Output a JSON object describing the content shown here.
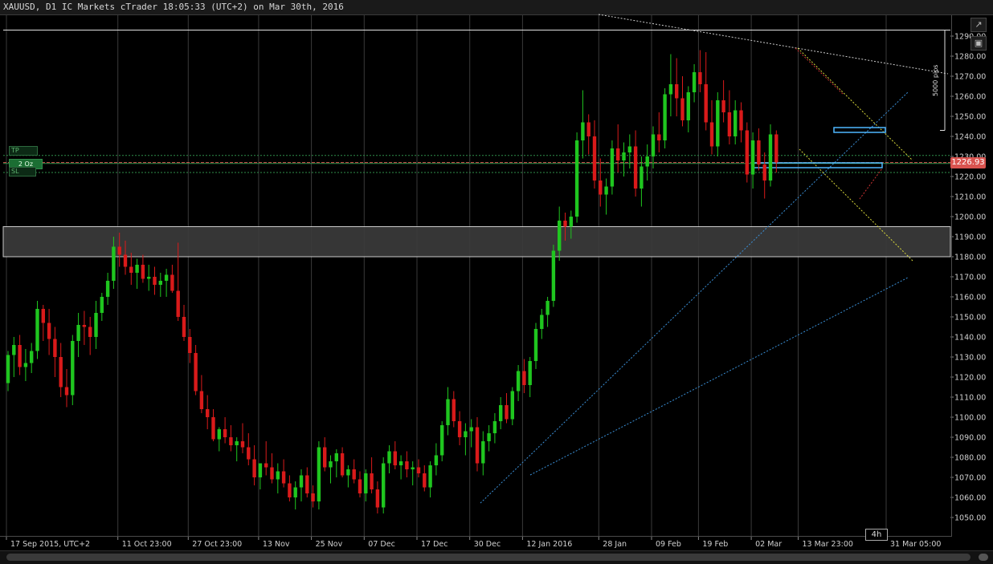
{
  "window": {
    "title": "XAUUSD, D1 IC Markets cTrader 18:05:33 (UTC+2) on Mar 30th, 2016"
  },
  "toolbar": {
    "detach_icon": "external-link-icon",
    "camera_icon": "camera-icon"
  },
  "timeframe_badge": "4h",
  "order": {
    "tp_label": "TP",
    "quantity_label": "2 Oz",
    "sl_label": "SL"
  },
  "measure": {
    "pips_label": "5000 pips"
  },
  "colors": {
    "bull": "#1fc61f",
    "bear": "#d91a1a",
    "background": "#000000",
    "current_price": "#d9534f"
  },
  "chart_data": {
    "type": "candlestick",
    "symbol": "XAUUSD",
    "timeframe": "D1",
    "current_price": 1226.93,
    "y_ticks": [
      1050,
      1060,
      1070,
      1080,
      1090,
      1100,
      1110,
      1120,
      1130,
      1140,
      1150,
      1160,
      1170,
      1180,
      1190,
      1200,
      1210,
      1220,
      1230,
      1240,
      1250,
      1260,
      1270,
      1280,
      1290
    ],
    "y_tick_labels": [
      "1050.00",
      "1060.00",
      "1070.00",
      "1080.00",
      "1090.00",
      "1100.00",
      "1110.00",
      "1120.00",
      "1130.00",
      "1140.00",
      "1150.00",
      "1160.00",
      "1170.00",
      "1180.00",
      "1190.00",
      "1200.00",
      "1210.00",
      "1220.00",
      "1230.00",
      "1240.00",
      "1250.00",
      "1260.00",
      "1270.00",
      "1280.00",
      "1290.00"
    ],
    "x_labels": [
      "17 Sep 2015, UTC+2",
      "11 Oct 23:00",
      "27 Oct 23:00",
      "13 Nov",
      "25 Nov",
      "07 Dec",
      "17 Dec",
      "30 Dec",
      "12 Jan 2016",
      "28 Jan",
      "09 Feb",
      "19 Feb",
      "02 Mar",
      "13 Mar 23:00",
      "31 Mar 05:00"
    ],
    "x_label_candle_index": [
      0,
      19,
      31,
      43,
      52,
      61,
      70,
      79,
      88,
      101,
      110,
      118,
      127,
      135,
      150
    ],
    "ohlc": [
      [
        1117,
        1133,
        1113,
        1131
      ],
      [
        1131,
        1140,
        1120,
        1136
      ],
      [
        1136,
        1141,
        1121,
        1125
      ],
      [
        1125,
        1134,
        1118,
        1127
      ],
      [
        1127,
        1137,
        1122,
        1133
      ],
      [
        1133,
        1158,
        1129,
        1154
      ],
      [
        1154,
        1156,
        1138,
        1147
      ],
      [
        1147,
        1154,
        1131,
        1139
      ],
      [
        1139,
        1145,
        1120,
        1130
      ],
      [
        1130,
        1137,
        1110,
        1115
      ],
      [
        1115,
        1124,
        1105,
        1111
      ],
      [
        1111,
        1141,
        1106,
        1138
      ],
      [
        1138,
        1152,
        1130,
        1146
      ],
      [
        1146,
        1153,
        1136,
        1145
      ],
      [
        1145,
        1150,
        1131,
        1140
      ],
      [
        1140,
        1158,
        1134,
        1152
      ],
      [
        1152,
        1162,
        1148,
        1160
      ],
      [
        1160,
        1172,
        1156,
        1168
      ],
      [
        1168,
        1190,
        1164,
        1185
      ],
      [
        1185,
        1192,
        1175,
        1181
      ],
      [
        1181,
        1188,
        1171,
        1175
      ],
      [
        1175,
        1182,
        1166,
        1172
      ],
      [
        1172,
        1179,
        1164,
        1176
      ],
      [
        1176,
        1181,
        1167,
        1169
      ],
      [
        1169,
        1176,
        1163,
        1170
      ],
      [
        1170,
        1175,
        1161,
        1166
      ],
      [
        1166,
        1172,
        1160,
        1168
      ],
      [
        1168,
        1174,
        1160,
        1171
      ],
      [
        1171,
        1176,
        1162,
        1163
      ],
      [
        1163,
        1187,
        1148,
        1150
      ],
      [
        1150,
        1156,
        1138,
        1140
      ],
      [
        1140,
        1144,
        1127,
        1132
      ],
      [
        1132,
        1136,
        1111,
        1113
      ],
      [
        1113,
        1121,
        1102,
        1104
      ],
      [
        1104,
        1111,
        1094,
        1100
      ],
      [
        1100,
        1104,
        1088,
        1089
      ],
      [
        1089,
        1095,
        1083,
        1094
      ],
      [
        1094,
        1100,
        1087,
        1090
      ],
      [
        1090,
        1096,
        1083,
        1086
      ],
      [
        1086,
        1090,
        1078,
        1088
      ],
      [
        1088,
        1097,
        1082,
        1085
      ],
      [
        1085,
        1092,
        1076,
        1079
      ],
      [
        1079,
        1086,
        1066,
        1070
      ],
      [
        1070,
        1077,
        1064,
        1077
      ],
      [
        1077,
        1088,
        1071,
        1075
      ],
      [
        1075,
        1082,
        1067,
        1069
      ],
      [
        1069,
        1077,
        1062,
        1073
      ],
      [
        1073,
        1079,
        1065,
        1067
      ],
      [
        1067,
        1071,
        1058,
        1060
      ],
      [
        1060,
        1068,
        1054,
        1065
      ],
      [
        1065,
        1074,
        1058,
        1071
      ],
      [
        1071,
        1075,
        1060,
        1062
      ],
      [
        1062,
        1066,
        1055,
        1058
      ],
      [
        1058,
        1088,
        1054,
        1085
      ],
      [
        1085,
        1090,
        1073,
        1075
      ],
      [
        1075,
        1081,
        1067,
        1078
      ],
      [
        1078,
        1084,
        1070,
        1082
      ],
      [
        1082,
        1085,
        1070,
        1071
      ],
      [
        1071,
        1076,
        1065,
        1074
      ],
      [
        1074,
        1079,
        1067,
        1069
      ],
      [
        1069,
        1073,
        1060,
        1062
      ],
      [
        1062,
        1074,
        1058,
        1072
      ],
      [
        1072,
        1080,
        1062,
        1064
      ],
      [
        1064,
        1068,
        1052,
        1055
      ],
      [
        1055,
        1080,
        1052,
        1077
      ],
      [
        1077,
        1086,
        1072,
        1083
      ],
      [
        1083,
        1088,
        1074,
        1076
      ],
      [
        1076,
        1081,
        1069,
        1078
      ],
      [
        1078,
        1083,
        1070,
        1074
      ],
      [
        1074,
        1078,
        1066,
        1075
      ],
      [
        1075,
        1079,
        1070,
        1072
      ],
      [
        1072,
        1076,
        1063,
        1065
      ],
      [
        1065,
        1078,
        1060,
        1076
      ],
      [
        1076,
        1087,
        1071,
        1081
      ],
      [
        1081,
        1098,
        1078,
        1096
      ],
      [
        1096,
        1115,
        1091,
        1109
      ],
      [
        1109,
        1113,
        1095,
        1098
      ],
      [
        1098,
        1103,
        1086,
        1090
      ],
      [
        1090,
        1097,
        1081,
        1093
      ],
      [
        1093,
        1099,
        1085,
        1095
      ],
      [
        1095,
        1100,
        1073,
        1077
      ],
      [
        1077,
        1093,
        1071,
        1088
      ],
      [
        1088,
        1096,
        1083,
        1092
      ],
      [
        1092,
        1102,
        1087,
        1098
      ],
      [
        1098,
        1110,
        1094,
        1106
      ],
      [
        1106,
        1112,
        1097,
        1099
      ],
      [
        1099,
        1115,
        1096,
        1113
      ],
      [
        1113,
        1126,
        1108,
        1123
      ],
      [
        1123,
        1129,
        1112,
        1116
      ],
      [
        1116,
        1130,
        1110,
        1128
      ],
      [
        1128,
        1147,
        1124,
        1144
      ],
      [
        1144,
        1154,
        1139,
        1151
      ],
      [
        1151,
        1160,
        1145,
        1158
      ],
      [
        1158,
        1186,
        1155,
        1183
      ],
      [
        1183,
        1205,
        1178,
        1198
      ],
      [
        1198,
        1202,
        1188,
        1195
      ],
      [
        1195,
        1203,
        1189,
        1200
      ],
      [
        1200,
        1242,
        1197,
        1238
      ],
      [
        1238,
        1263,
        1229,
        1247
      ],
      [
        1247,
        1251,
        1231,
        1240
      ],
      [
        1240,
        1248,
        1214,
        1218
      ],
      [
        1218,
        1229,
        1205,
        1211
      ],
      [
        1211,
        1219,
        1201,
        1215
      ],
      [
        1215,
        1238,
        1211,
        1234
      ],
      [
        1234,
        1246,
        1222,
        1228
      ],
      [
        1228,
        1237,
        1220,
        1232
      ],
      [
        1232,
        1241,
        1224,
        1235
      ],
      [
        1235,
        1243,
        1210,
        1214
      ],
      [
        1214,
        1230,
        1205,
        1225
      ],
      [
        1225,
        1236,
        1218,
        1230
      ],
      [
        1230,
        1245,
        1224,
        1241
      ],
      [
        1241,
        1252,
        1232,
        1238
      ],
      [
        1238,
        1264,
        1234,
        1261
      ],
      [
        1261,
        1281,
        1250,
        1266
      ],
      [
        1266,
        1279,
        1250,
        1259
      ],
      [
        1259,
        1270,
        1245,
        1248
      ],
      [
        1248,
        1265,
        1242,
        1262
      ],
      [
        1262,
        1276,
        1257,
        1272
      ],
      [
        1272,
        1283,
        1262,
        1266
      ],
      [
        1266,
        1282,
        1243,
        1247
      ],
      [
        1247,
        1258,
        1231,
        1235
      ],
      [
        1235,
        1262,
        1230,
        1258
      ],
      [
        1258,
        1268,
        1247,
        1252
      ],
      [
        1252,
        1263,
        1236,
        1240
      ],
      [
        1240,
        1258,
        1236,
        1253
      ],
      [
        1253,
        1257,
        1237,
        1243
      ],
      [
        1243,
        1247,
        1217,
        1221
      ],
      [
        1221,
        1242,
        1214,
        1238
      ],
      [
        1238,
        1244,
        1223,
        1226
      ],
      [
        1226,
        1232,
        1209,
        1218
      ],
      [
        1218,
        1246,
        1215,
        1241
      ],
      [
        1241,
        1243,
        1222,
        1227
      ]
    ]
  }
}
